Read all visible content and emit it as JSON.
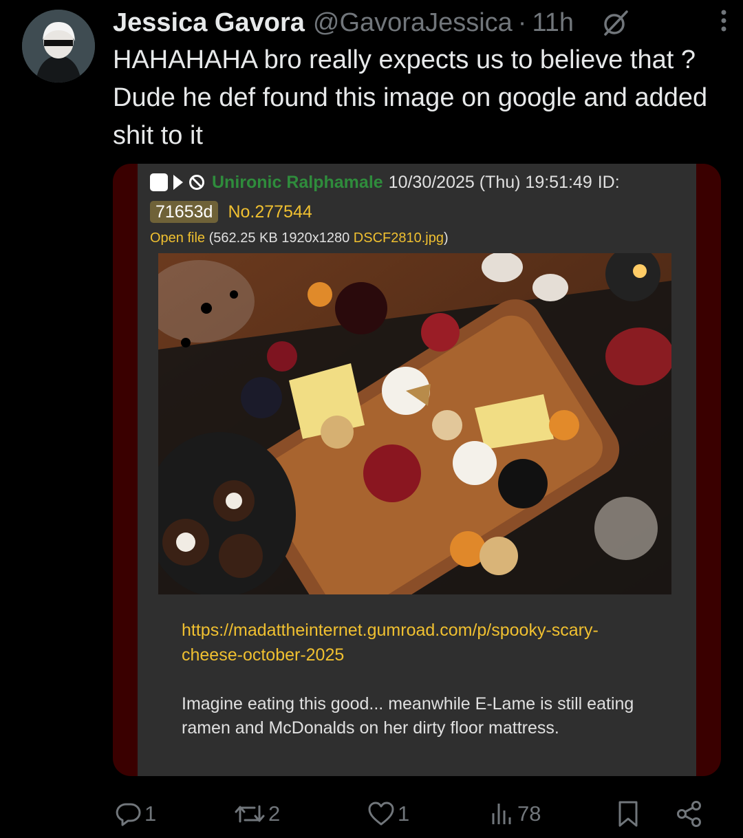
{
  "tweet": {
    "display_name": "Jessica Gavora",
    "handle": "@GavoraJessica",
    "separator": "·",
    "time": "11h",
    "text": "HAHAHAHA bro really expects us to believe that ? Dude he def found this image on google and added shit to it"
  },
  "quoted_post": {
    "name": "Unironic Ralphamale",
    "datetime": "10/30/2025 (Thu) 19:51:49",
    "id_label": "ID:",
    "id": "71653d",
    "number": "No.277544",
    "open_file": "Open file",
    "file_info_open": " (562.25 KB 1920x1280 ",
    "file_name": "DSCF2810.jpg",
    "file_info_close": ")",
    "link": "https://madattheinternet.gumroad.com/p/spooky-scary-cheese-october-2025",
    "body": "Imagine eating this good... meanwhile E-Lame is still eating ramen and McDonalds on her dirty floor mattress."
  },
  "actions": {
    "replies": "1",
    "reposts": "2",
    "likes": "1",
    "views": "78"
  },
  "icons": [
    "grok-icon",
    "more-icon",
    "reply-icon",
    "repost-icon",
    "like-icon",
    "views-icon",
    "bookmark-icon",
    "share-icon"
  ],
  "colors": {
    "background": "#000000",
    "text": "#e7e9ea",
    "muted": "#71767b",
    "post_bg": "#2f2f2f",
    "card_border": "#3a0000",
    "poster_name": "#2f8c3c",
    "link": "#f0c030"
  }
}
